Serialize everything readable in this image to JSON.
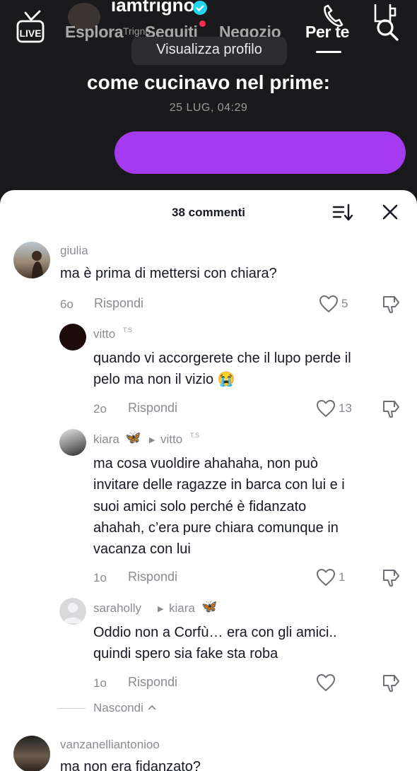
{
  "top_nav": {
    "live_label": "LIVE",
    "tabs": [
      {
        "label": "Esplora"
      },
      {
        "label": "Seguiti"
      },
      {
        "label": "Negozio"
      },
      {
        "label": "Per te"
      }
    ],
    "active_tab": "Per te",
    "notification_color": "#fe2c55"
  },
  "video": {
    "author_name": "iamtrigno",
    "author_sub": "Trigno",
    "profile_button": "Visualizza profilo",
    "caption": "come cucinavo nel prime:",
    "date": "25 LUG, 04:29",
    "accent_color": "#a43bf0"
  },
  "comments_sheet": {
    "title": "38 commenti",
    "comments": [
      {
        "user": "giulia",
        "text": "ma è prima di mettersi con chiara?",
        "time": "6o",
        "reply_label": "Rispondi",
        "likes": "5"
      },
      {
        "user": "vitto",
        "tag": "T.S",
        "text_lines": [
          "quando vi accorgerete che il lupo perde il",
          "pelo ma non il vizio 😭"
        ],
        "time": "2o",
        "reply_label": "Rispondi",
        "likes": "13"
      },
      {
        "user": "kiara",
        "reply_to": "vitto",
        "tag": "T.S",
        "text_lines": [
          "ma cosa vuoldire ahahaha, non può",
          "invitare delle ragazze in barca con lui e i",
          "suoi amici solo perché è fidanzato",
          "ahahah, c’era pure chiara comunque in",
          "vacanza con lui"
        ],
        "time": "1o",
        "reply_label": "Rispondi",
        "likes": "1"
      },
      {
        "user": "saraholly",
        "reply_to": "kiara",
        "text_lines": [
          "Oddio non a Corfù… era con gli amici..",
          "quindi spero sia fake sta roba"
        ],
        "time": "1o",
        "reply_label": "Rispondi",
        "likes": ""
      },
      {
        "user": "vanzanelliantonioo",
        "text": "ma non era fidanzato?"
      }
    ],
    "hide_label": "Nascondi"
  }
}
